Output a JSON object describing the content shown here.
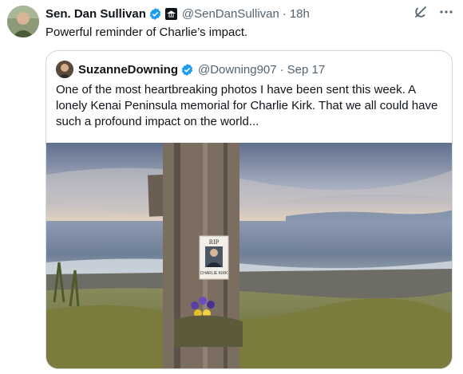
{
  "post": {
    "author_name": "Sen. Dan Sullivan",
    "handle": "@SenDanSullivan",
    "separator": "·",
    "time": "18h",
    "text": "Powerful reminder of Charlie’s impact."
  },
  "quote": {
    "author_name": "SuzanneDowning",
    "handle": "@Downing907",
    "separator": "·",
    "date": "Sep 17",
    "text": "One of the most heartbreaking photos I have been sent this week. A lonely Kenai Peninsula memorial for Charlie Kirk. That we all could have such a profound impact on the world..."
  },
  "memorial_sign": {
    "rip": "RIP",
    "name": "CHARLIE KIRK"
  },
  "icons": [
    "verified-badge-icon",
    "government-badge-icon",
    "grok-icon",
    "more-options-icon"
  ],
  "colors": {
    "verified": "#1d9bf0",
    "secondary_text": "#536471",
    "border": "#cfd9de"
  }
}
